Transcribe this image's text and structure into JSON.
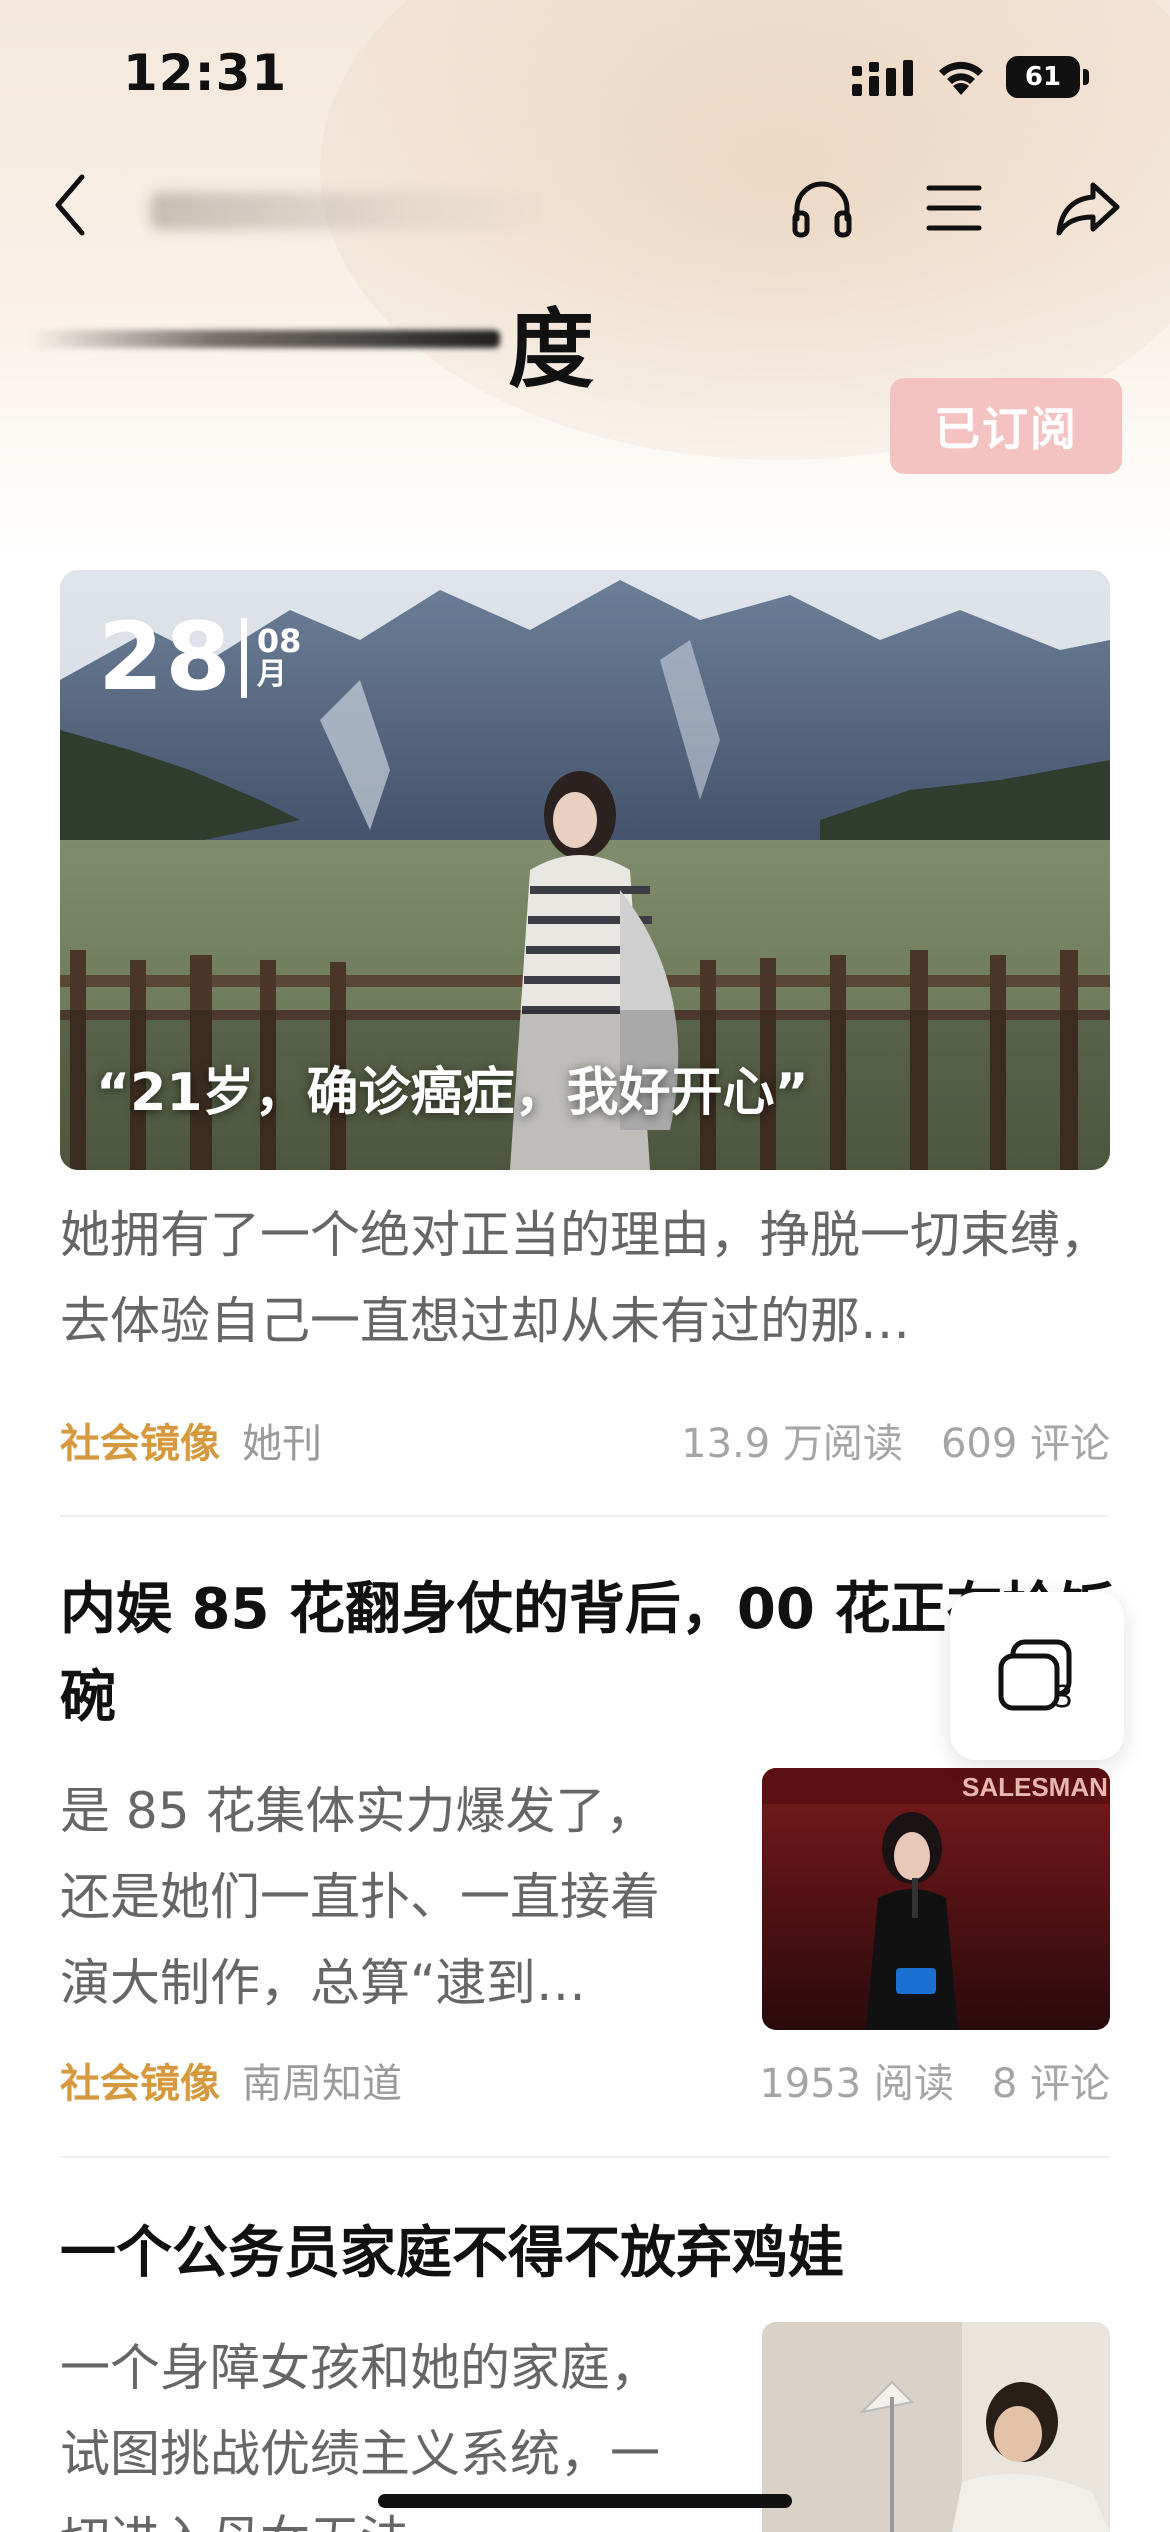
{
  "status_bar": {
    "time": "12:31",
    "battery": "61"
  },
  "header": {
    "channel_name": "度",
    "subscribe_label": "已订阅"
  },
  "featured": {
    "date_day": "28",
    "date_month": "08",
    "date_month_unit": "月",
    "caption": "“21岁，确诊癌症，我好开心”",
    "summary": "她拥有了一个绝对正当的理由，挣脱一切束缚，去体验自己一直想过却从未有过的那…",
    "tag": "社会镜像",
    "source": "她刊",
    "reads": "13.9 万阅读",
    "comments": "609 评论"
  },
  "articles": [
    {
      "title": "内娱 85 花翻身仗的背后，00 花正在抢饭碗",
      "summary": "是 85 花集体实力爆发了，还是她们一直扑、一直接着演大制作，总算“逮到…",
      "tag": "社会镜像",
      "source": "南周知道",
      "reads": "1953 阅读",
      "comments": "8 评论",
      "thumb_text": "SALESMAN"
    },
    {
      "title": "一个公务员家庭不得不放弃鸡娃",
      "summary": "一个身障女孩和她的家庭，试图挑战优绩主义系统，一切进入母女无法…"
    }
  ],
  "floating_windows": {
    "count": "3"
  },
  "icons": {
    "back": "chevron-left-icon",
    "listen": "headphones-icon",
    "menu": "menu-icon",
    "share": "share-icon",
    "windows": "stacked-windows-icon"
  },
  "colors": {
    "tag": "#d59a3f",
    "subscribe_bg": "#f5c2c2"
  }
}
